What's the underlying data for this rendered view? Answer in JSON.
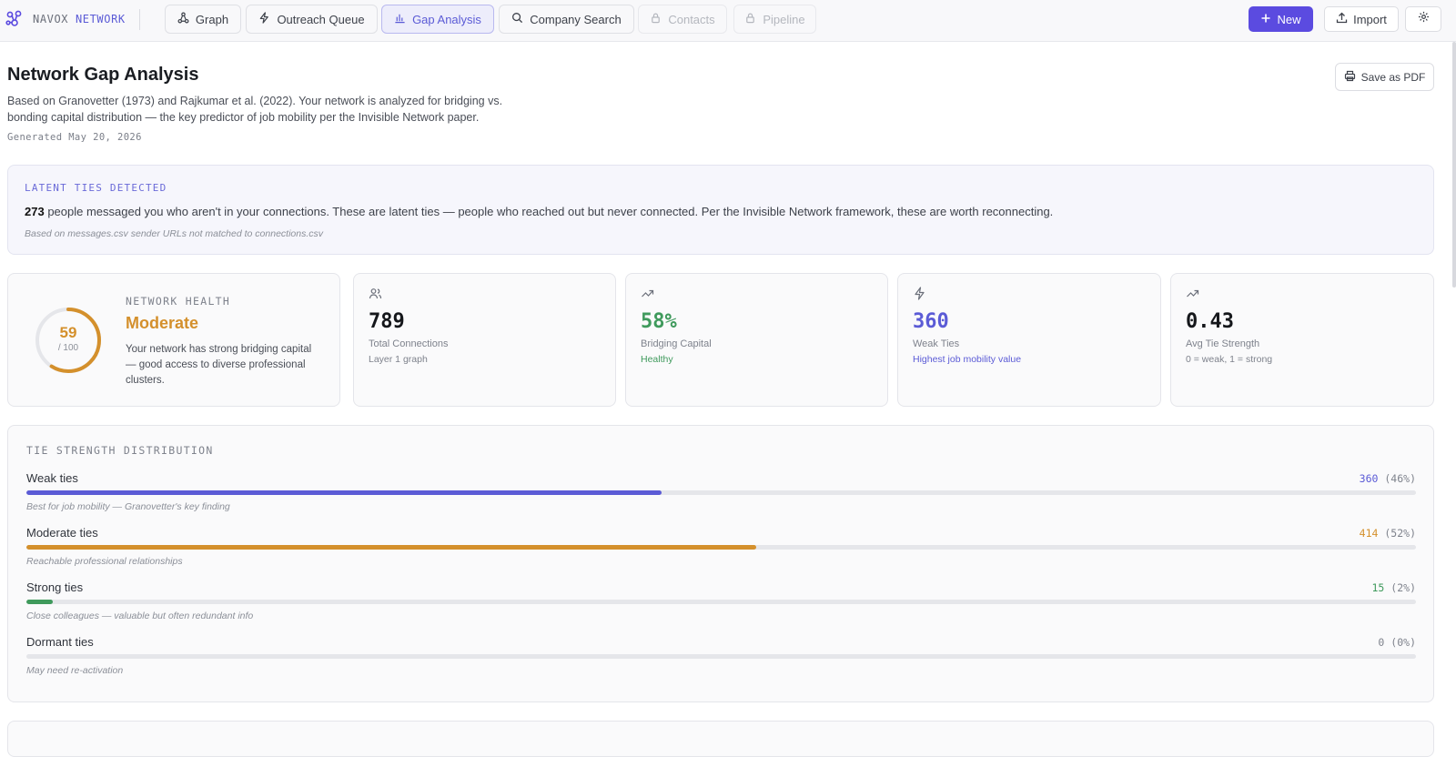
{
  "brand": {
    "name": "NAVOX",
    "accent": "NETWORK"
  },
  "nav": {
    "tabs": [
      {
        "label": "Graph",
        "icon": "graph-icon",
        "state": "default"
      },
      {
        "label": "Outreach Queue",
        "icon": "bolt-icon",
        "state": "default"
      },
      {
        "label": "Gap Analysis",
        "icon": "bar-chart-icon",
        "state": "active"
      },
      {
        "label": "Company Search",
        "icon": "search-icon",
        "state": "default"
      },
      {
        "label": "Contacts",
        "icon": "lock-icon",
        "state": "disabled"
      },
      {
        "label": "Pipeline",
        "icon": "lock-icon",
        "state": "disabled"
      }
    ],
    "new_label": "New",
    "import_label": "Import"
  },
  "header": {
    "title": "Network Gap Analysis",
    "description": "Based on Granovetter (1973) and Rajkumar et al. (2022). Your network is analyzed for bridging vs. bonding capital distribution — the key predictor of job mobility per the Invisible Network paper.",
    "generated": "Generated May 20, 2026",
    "pdf_label": "Save as PDF"
  },
  "latent": {
    "label": "LATENT TIES DETECTED",
    "count": "273",
    "text": " people messaged you who aren't in your connections. These are latent ties — people who reached out but never connected. Per the Invisible Network framework, these are worth reconnecting.",
    "note": "Based on messages.csv sender URLs not matched to connections.csv"
  },
  "health": {
    "label": "NETWORK HEALTH",
    "score": "59",
    "score_max": "/ 100",
    "score_fraction": 0.59,
    "status": "Moderate",
    "description": "Your network has strong bridging capital — good access to diverse professional clusters.",
    "color": "#d4902c"
  },
  "stats": [
    {
      "icon": "users-icon",
      "value": "789",
      "label": "Total Connections",
      "sub": "Layer 1 graph",
      "color": "#15171b",
      "sub_color": "#7e828c"
    },
    {
      "icon": "trending-up-icon",
      "value": "58%",
      "label": "Bridging Capital",
      "sub": "Healthy",
      "color": "#3f9a5c",
      "sub_color": "#3f9a5c"
    },
    {
      "icon": "bolt-icon",
      "value": "360",
      "label": "Weak Ties",
      "sub": "Highest job mobility value",
      "color": "#5b5bd6",
      "sub_color": "#5b5bd6"
    },
    {
      "icon": "trending-up-icon",
      "value": "0.43",
      "label": "Avg Tie Strength",
      "sub": "0 = weak, 1 = strong",
      "color": "#15171b",
      "sub_color": "#7e828c"
    }
  ],
  "distribution": {
    "title": "TIE STRENGTH DISTRIBUTION",
    "rows": [
      {
        "label": "Weak ties",
        "count": "360",
        "pct": "(46%)",
        "fraction": 0.457,
        "note": "Best for job mobility — Granovetter's key finding",
        "color": "#5b5bd6"
      },
      {
        "label": "Moderate ties",
        "count": "414",
        "pct": "(52%)",
        "fraction": 0.525,
        "note": "Reachable professional relationships",
        "color": "#d4902c"
      },
      {
        "label": "Strong ties",
        "count": "15",
        "pct": "(2%)",
        "fraction": 0.019,
        "note": "Close colleagues — valuable but often redundant info",
        "color": "#3f9a5c"
      },
      {
        "label": "Dormant ties",
        "count": "0",
        "pct": "(0%)",
        "fraction": 0,
        "note": "May need re-activation",
        "color": "#7e828c"
      }
    ]
  }
}
